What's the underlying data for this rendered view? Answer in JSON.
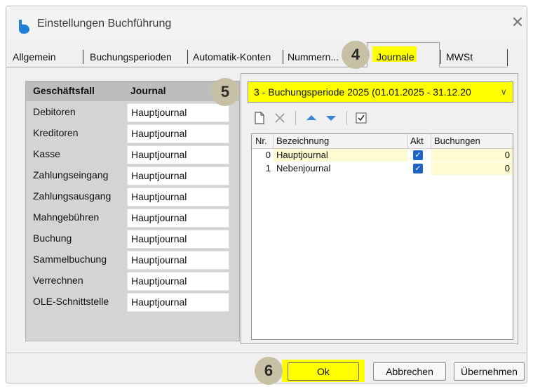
{
  "window": {
    "title": "Einstellungen Buchführung",
    "close": "✕"
  },
  "tabs": [
    {
      "label": "Allgemein"
    },
    {
      "label": "Buchungsperioden"
    },
    {
      "label": "Automatik-Konten"
    },
    {
      "label": "Nummern..."
    },
    {
      "label": "Journale",
      "selected": true
    },
    {
      "label": "MWSt"
    }
  ],
  "badges": {
    "journale": "4",
    "period": "5",
    "ok": "6"
  },
  "left_table": {
    "headers": {
      "case": "Geschäftsfall",
      "journal": "Journal"
    },
    "rows": [
      {
        "case": "Debitoren",
        "journal": "Hauptjournal"
      },
      {
        "case": "Kreditoren",
        "journal": "Hauptjournal"
      },
      {
        "case": "Kasse",
        "journal": "Hauptjournal"
      },
      {
        "case": "Zahlungseingang",
        "journal": "Hauptjournal"
      },
      {
        "case": "Zahlungsausgang",
        "journal": "Hauptjournal"
      },
      {
        "case": "Mahngebühren",
        "journal": "Hauptjournal"
      },
      {
        "case": "Buchung",
        "journal": "Hauptjournal"
      },
      {
        "case": "Sammelbuchung",
        "journal": "Hauptjournal"
      },
      {
        "case": "Verrechnen",
        "journal": "Hauptjournal"
      },
      {
        "case": "OLE-Schnittstelle",
        "journal": "Hauptjournal"
      }
    ]
  },
  "period": {
    "selected": "3 - Buchungsperiode 2025 (01.01.2025 - 31.12.20"
  },
  "toolbar": {
    "icons": [
      "new-icon",
      "delete-icon",
      "up-icon",
      "down-icon",
      "check-icon"
    ]
  },
  "journal_grid": {
    "headers": {
      "nr": "Nr.",
      "name": "Bezeichnung",
      "akt": "Akt",
      "buchungen": "Buchungen"
    },
    "rows": [
      {
        "nr": "0",
        "name": "Hauptjournal",
        "akt": true,
        "buchungen": "0"
      },
      {
        "nr": "1",
        "name": "Nebenjournal",
        "akt": true,
        "buchungen": "0"
      }
    ]
  },
  "buttons": {
    "ok": "Ok",
    "cancel": "Abbrechen",
    "apply": "Übernehmen"
  },
  "colors": {
    "highlight": "#ffff00",
    "accent": "#1e64c8",
    "cell_yellow": "#fffbd0"
  }
}
